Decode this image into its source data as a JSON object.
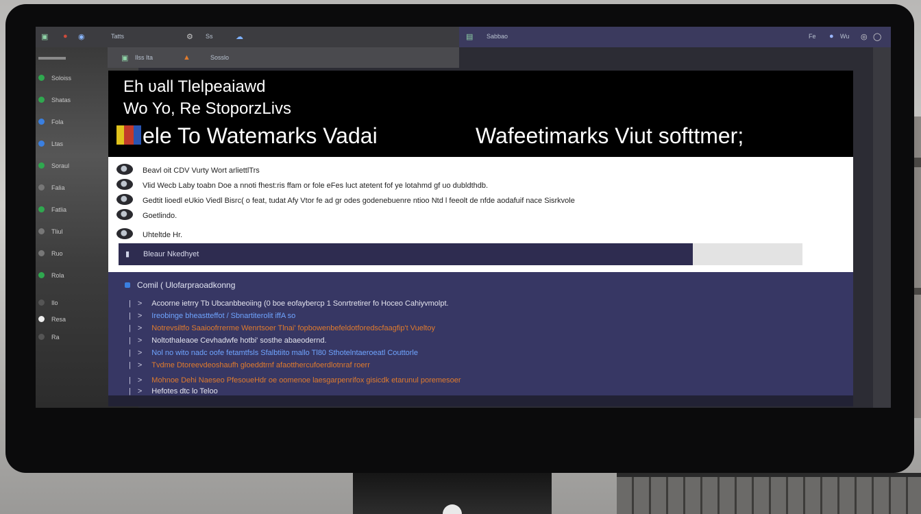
{
  "toolbar": {
    "left_items": [
      "Tatts",
      "Ss"
    ],
    "right_title": "Sabbao",
    "right_items": [
      "Fe",
      "Wu"
    ]
  },
  "subbar": {
    "items": [
      "Ilss Ita",
      "Sosslo"
    ]
  },
  "left_panel": {
    "rows": [
      "Soloiss",
      "Shatas",
      "Fola",
      "Ltas",
      "Soraul",
      "Falia",
      "Fatlia",
      "Tliul",
      "Ruo",
      "Rola",
      "Ilo",
      "Resa",
      "Ra"
    ]
  },
  "header": {
    "line1": "Eh ʋall Tlelpeaiawd",
    "line2": "Wo Yo, Re StoporzLivs",
    "line3": "ele To Watemarks Vadai",
    "line4": "Wafeetimarks Viut softtmer;"
  },
  "content": {
    "rows": [
      "Beavl oit CDV Vurty Wort arliettlTrs",
      "Vlid Wecb Laby toabn Doe a nnoti fhest:ris ffam or fole eFes luct atetent fof ye lotahmd gf uo dubldthdb.",
      "Gedtit lioedl eUkio Viedl Bisrc( o feat, tudat Afy Vtor fe ad gr odes godenebuenre ntioo Ntd l feeolt de nfde aodafuif nace Sisrkvole",
      "Goetlindo.",
      "Uhteltde Hr."
    ]
  },
  "search": {
    "label": "Bleaur Nkedhyet"
  },
  "log": {
    "title": "Comil ( Ulofarpraoadkonng",
    "rows": [
      {
        "text": "Acoorne ietrry Tb Ubcanbbeoiing (0 boe eofaybercp 1 Sonrtretirer fo Hoceo Cahiyvmolpt.",
        "style": "plain"
      },
      {
        "text": "Ireobinge bheastteffot / Sbnartiterolit iffA so",
        "style": "blue"
      },
      {
        "text": "Notrevsiltfo Saaioofrrerme Wenrtsoer Tlnai' fopbowenbefeldotforedscfaagfip't Vueltoy",
        "style": "hl"
      },
      {
        "text": "Noltothaleaoe Cevhadwfe hotbi' sosthe abaeodernd.",
        "style": "plain"
      },
      {
        "text": "Nol no wito nadc oofe fetamtfsls Sfalbtiito mallo Tl80 Sthotelntaeroeatl Couttorle",
        "style": "blue"
      },
      {
        "text": "Tvdme Dtoreevdeoshaufh gloeddtrnf afaotthercufoerdlotnraf roerr",
        "style": "hl"
      },
      {
        "text": "Mohnoe Dehi Naeseo PfesoueHdr oe oomenoe laesgarpenrifox gisicdk etarunul poremesoer",
        "style": "hl"
      },
      {
        "text": "Hefotes dtc lo Teloo",
        "style": "plain"
      }
    ]
  }
}
